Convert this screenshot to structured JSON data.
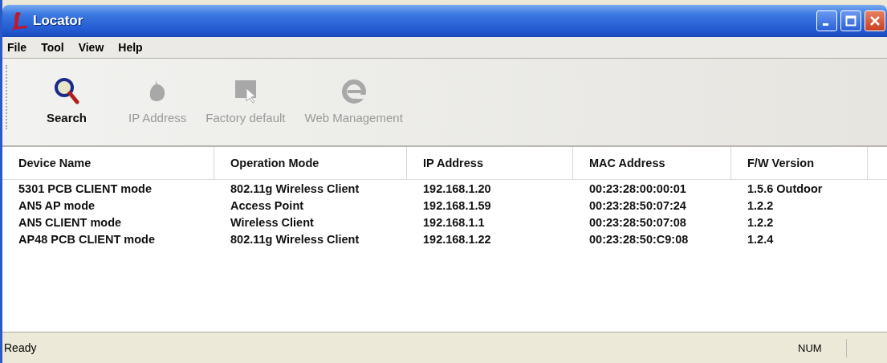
{
  "window": {
    "title": "Locator"
  },
  "menu": [
    "File",
    "Tool",
    "View",
    "Help"
  ],
  "toolbar": [
    {
      "kind": "search",
      "label": "Search",
      "disabled": false
    },
    {
      "kind": "ip",
      "label": "IP Address",
      "disabled": true
    },
    {
      "kind": "factory",
      "label": "Factory default",
      "disabled": true
    },
    {
      "kind": "web",
      "label": "Web Management",
      "disabled": true
    }
  ],
  "table": {
    "columns": [
      "Device Name",
      "Operation Mode",
      "IP Address",
      "MAC Address",
      "F/W Version"
    ],
    "rows": [
      [
        "5301 PCB CLIENT mode",
        "802.11g Wireless Client",
        "192.168.1.20",
        "00:23:28:00:00:01",
        "1.5.6 Outdoor"
      ],
      [
        "AN5 AP mode",
        "Access Point",
        "192.168.1.59",
        "00:23:28:50:07:24",
        "1.2.2"
      ],
      [
        "AN5 CLIENT mode",
        "Wireless Client",
        "192.168.1.1",
        "00:23:28:50:07:08",
        "1.2.2"
      ],
      [
        "AP48 PCB CLIENT mode",
        "802.11g Wireless Client",
        "192.168.1.22",
        "00:23:28:50:C9:08",
        "1.2.4"
      ]
    ]
  },
  "status_bar": {
    "text": "Ready",
    "indicator": "NUM"
  }
}
